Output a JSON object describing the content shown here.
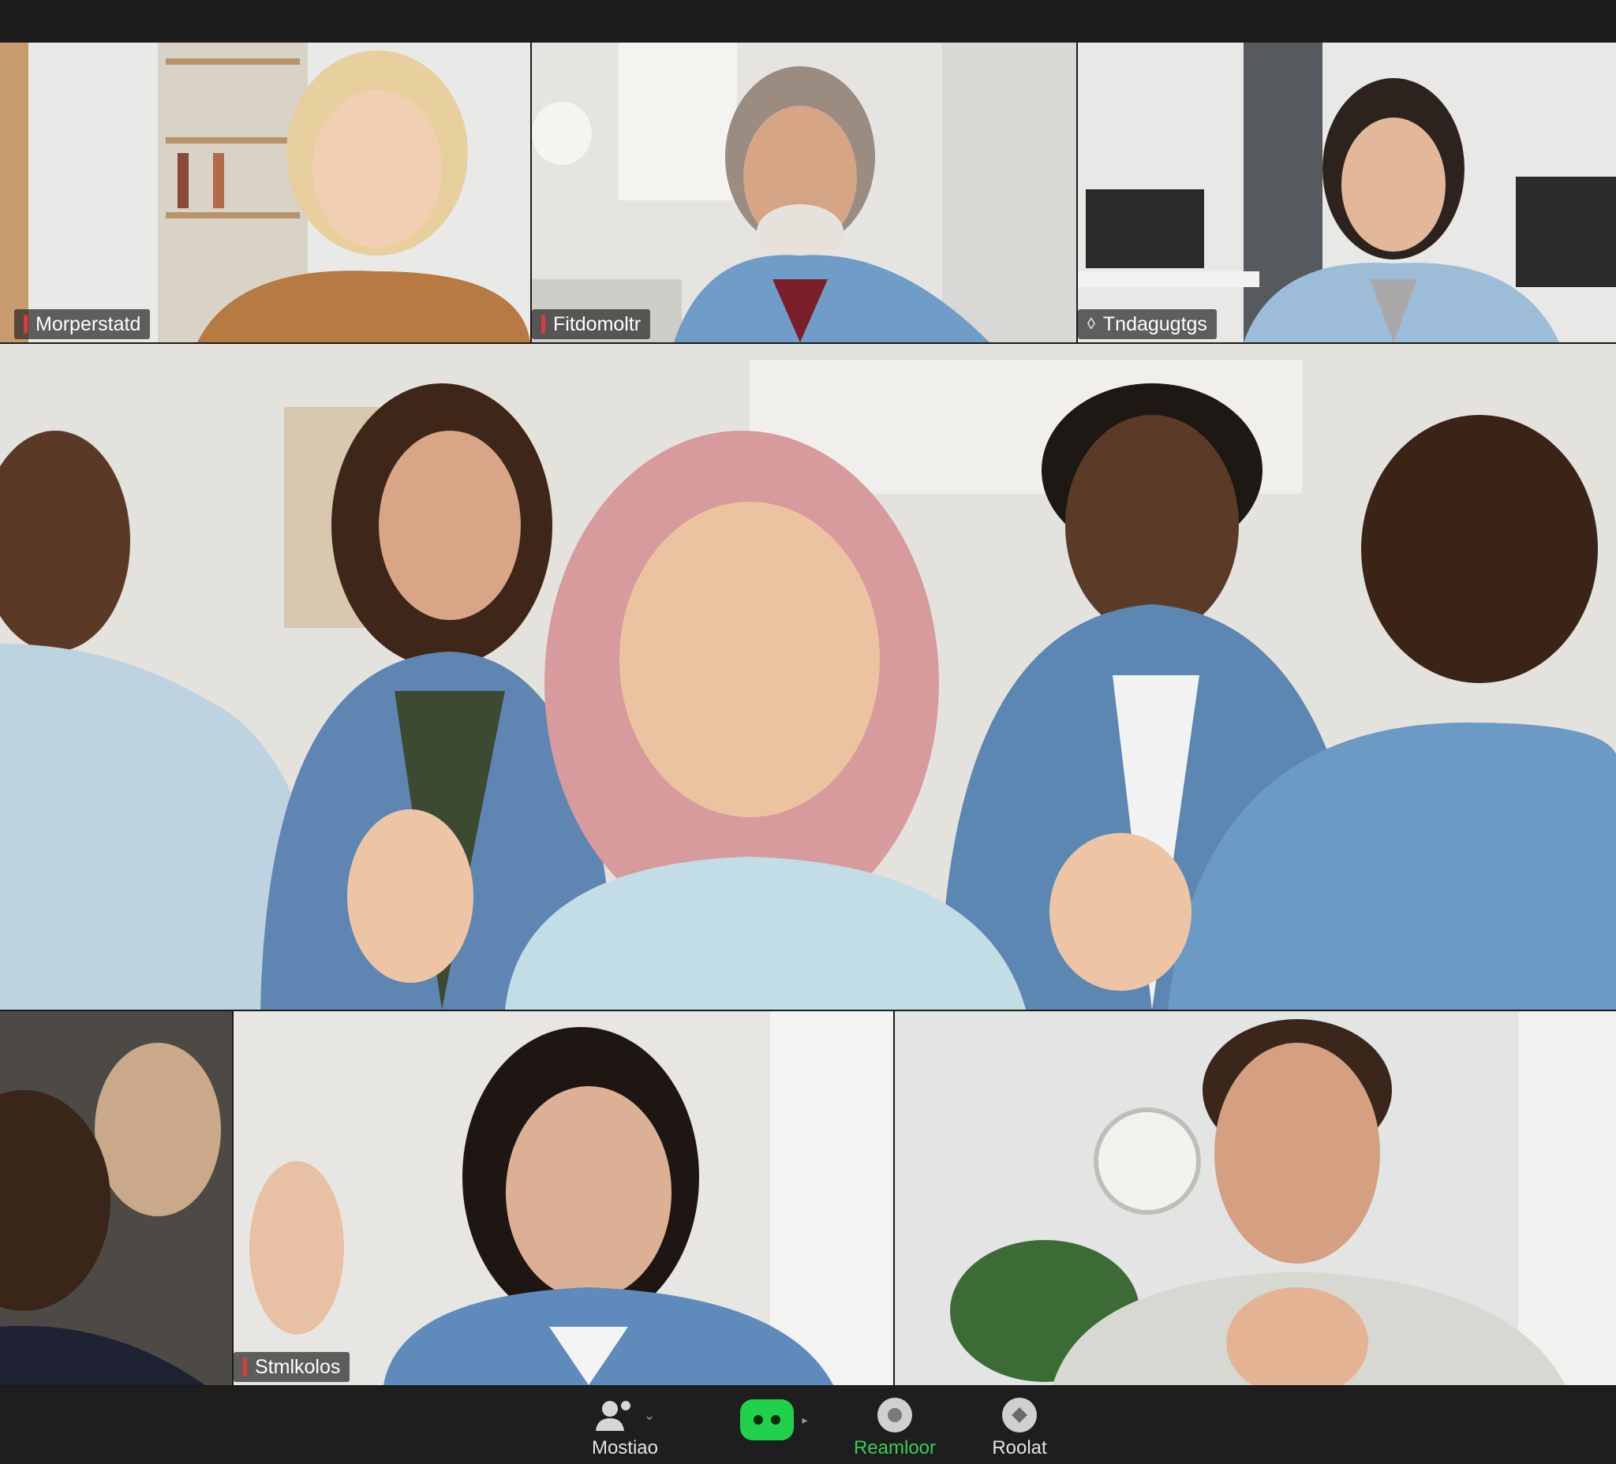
{
  "participants": [
    {
      "id": "p1",
      "name": "Morperstatd",
      "mic": "muted"
    },
    {
      "id": "p2",
      "name": "Fitdomoltr",
      "mic": "muted"
    },
    {
      "id": "p3",
      "name": "Tndagugtgs",
      "mic": "pinned"
    },
    {
      "id": "p7",
      "name": "Stmlkolos",
      "mic": "muted"
    }
  ],
  "controls": {
    "participants_label": "Mostiao",
    "record_label": "Reamloor",
    "react_label": "Roolat"
  },
  "colors": {
    "accent_green": "#21d14a",
    "muted_red": "#e03a3a"
  }
}
